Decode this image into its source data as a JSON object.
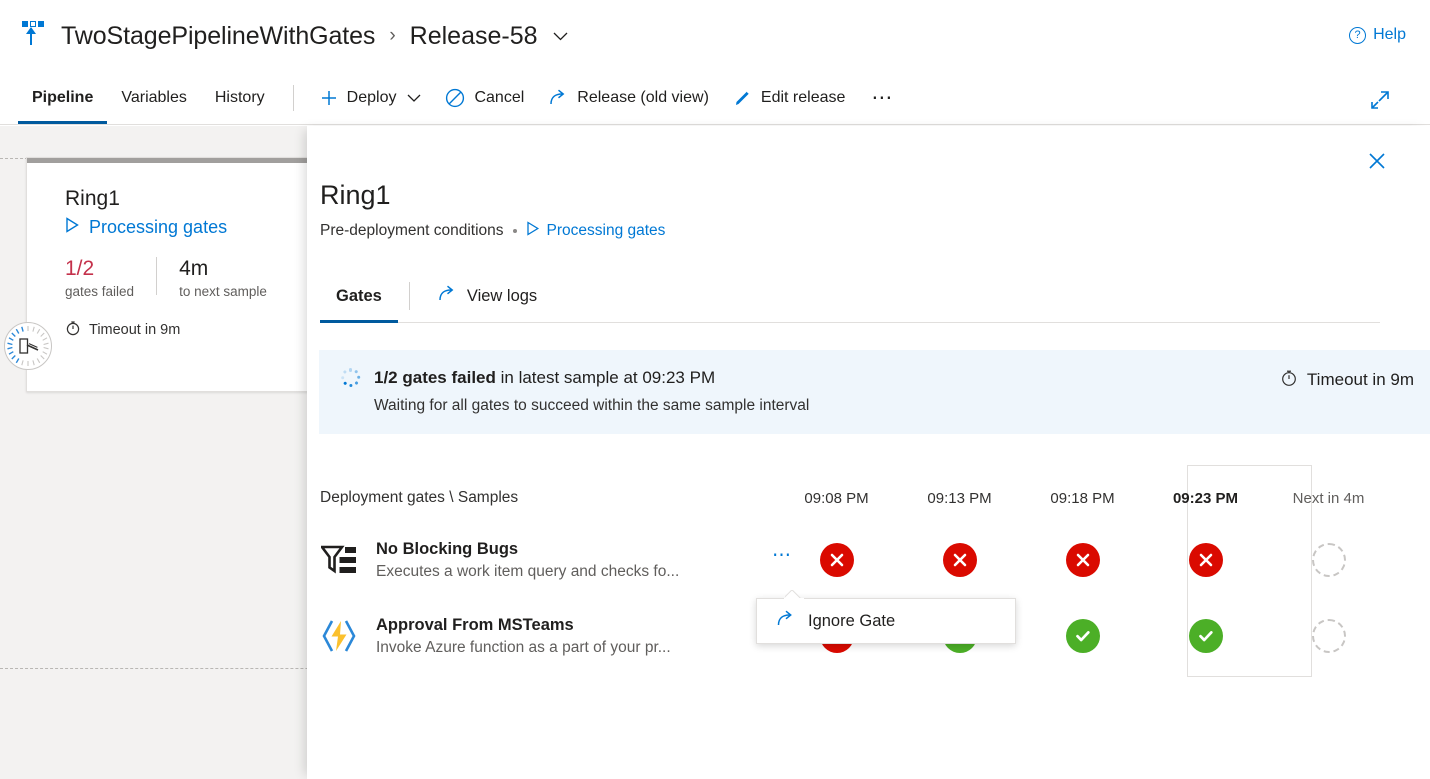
{
  "header": {
    "logo_icon": "pipelines-logo-icon",
    "project": "TwoStagePipelineWithGates",
    "separator": "›",
    "release": "Release-58",
    "release_chevron": "⌄",
    "help_label": "Help",
    "help_icon": "question-circle-icon"
  },
  "toolbar": {
    "tabs": [
      {
        "label": "Pipeline",
        "active": true
      },
      {
        "label": "Variables",
        "active": false
      },
      {
        "label": "History",
        "active": false
      }
    ],
    "deploy_label": "Deploy",
    "deploy_icon": "plus-icon",
    "deploy_chevron": "⌄",
    "cancel_label": "Cancel",
    "cancel_icon": "cancel-circle-icon",
    "release_old_view_label": "Release (old view)",
    "release_old_view_icon": "share-arrow-icon",
    "edit_release_label": "Edit release",
    "edit_release_icon": "pencil-icon",
    "more_label": "⋯",
    "expand_icon": "fullscreen-arrow-icon"
  },
  "stage_card": {
    "name": "Ring1",
    "status_label": "Processing gates",
    "status_icon": "play-triangle-icon",
    "gate_badge_icon": "gate-barrier-icon",
    "metrics": [
      {
        "value": "1/2",
        "label": "gates failed",
        "state": "failed"
      },
      {
        "value": "4m",
        "label": "to next sample",
        "state": "normal"
      }
    ],
    "timeout_label": "Timeout in 9m",
    "timeout_icon": "timer-icon"
  },
  "panel": {
    "close_icon": "close-icon",
    "title": "Ring1",
    "subtitle": "Pre-deployment conditions",
    "subtitle_dot": "•",
    "status_link": "Processing gates",
    "status_link_icon": "play-triangle-icon",
    "tabs": [
      {
        "label": "Gates",
        "active": true,
        "icon": null
      },
      {
        "label": "View logs",
        "active": false,
        "icon": "share-arrow-icon"
      }
    ],
    "banner": {
      "spinner_icon": "spinner-icon",
      "highlight": "1/2 gates failed",
      "rest": " in latest sample at 09:23 PM",
      "subtext": "Waiting for all gates to succeed within the same sample interval",
      "timeout_icon": "timer-icon",
      "timeout_label": "Timeout in 9m"
    },
    "table": {
      "name_header": "Deployment gates \\ Samples",
      "columns": [
        {
          "label": "09:08 PM",
          "current": false,
          "next": false
        },
        {
          "label": "09:13 PM",
          "current": false,
          "next": false
        },
        {
          "label": "09:18 PM",
          "current": false,
          "next": false
        },
        {
          "label": "09:23 PM",
          "current": true,
          "next": false
        },
        {
          "label": "Next in 4m",
          "current": false,
          "next": true
        }
      ],
      "rows": [
        {
          "icon": "work-item-query-icon",
          "title": "No Blocking Bugs",
          "description": "Executes a work item query and checks fo...",
          "menu_icon": "ellipsis-icon",
          "statuses": [
            "fail",
            "fail",
            "fail",
            "fail",
            "pending"
          ]
        },
        {
          "icon": "azure-function-icon",
          "title": "Approval From MSTeams",
          "description": "Invoke Azure function as a part of your pr...",
          "menu_icon": null,
          "statuses": [
            "fail",
            "pass",
            "pass",
            "pass",
            "pending"
          ]
        }
      ]
    },
    "callout": {
      "icon": "share-arrow-icon",
      "label": "Ignore Gate"
    }
  },
  "colors": {
    "accent": "#0078d4",
    "fail": "#da0a00",
    "pass": "#4caf27",
    "banner_bg": "#eff6fc",
    "canvas_bg": "#f3f2f1",
    "tab_underline": "#005a9e",
    "fail_text": "#c4314b"
  }
}
